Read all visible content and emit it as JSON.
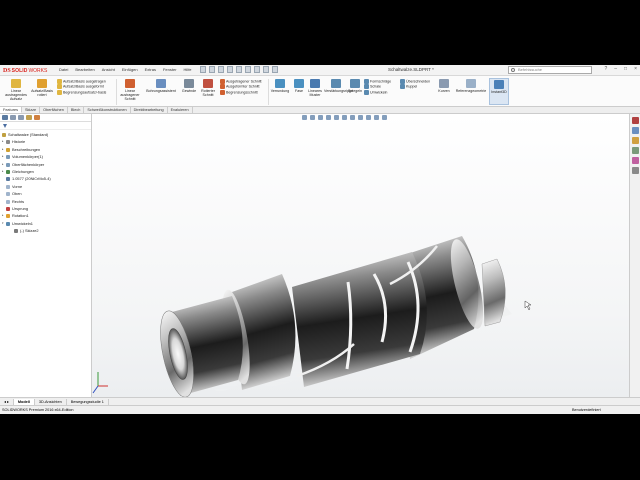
{
  "app": {
    "logo_prefix": "DS",
    "logo_bold": "SOLID",
    "logo_light": "WORKS",
    "document_title": "Schaltwalze.SLDPRT *",
    "search_placeholder": "Befehlssuche"
  },
  "menu": [
    "Datei",
    "Bearbeiten",
    "Ansicht",
    "Einfügen",
    "Extras",
    "Fenster",
    "Hilfe"
  ],
  "ribbon": {
    "big_buttons": [
      {
        "label": "Linear\naustragendes\nAufsatz",
        "icon": "boss-extrude-icon",
        "color": "#e0b640"
      },
      {
        "label": "Aufsatz/Basis\nrotiert",
        "icon": "revolved-boss-icon",
        "color": "#e0a030"
      },
      {
        "label": "Linear\naustragener\nSchnitt",
        "icon": "extruded-cut-icon",
        "color": "#d06030"
      },
      {
        "label": "Bohrungsassistent",
        "icon": "hole-wizard-icon",
        "color": "#6a8fc0"
      },
      {
        "label": "Gewinde",
        "icon": "thread-icon",
        "color": "#7a8a9a"
      },
      {
        "label": "Rotierter\nSchnitt",
        "icon": "revolved-cut-icon",
        "color": "#c05040"
      }
    ],
    "small_group_1": [
      "Aufsatz/Basis ausgetragen",
      "Aufsatz/Basis ausgeformt",
      "Begrenzungsaufsatz/-basis"
    ],
    "small_group_2": [
      "Ausgetragener Schnitt",
      "Ausgeformter Schnitt",
      "Begrenzungsschnitt"
    ],
    "feature_buttons": [
      {
        "label": "Verrundung",
        "icon": "fillet-icon",
        "color": "#4a90c0"
      },
      {
        "label": "Fase",
        "icon": "chamfer-icon",
        "color": "#4a90c0"
      },
      {
        "label": "Lineares\nMuster",
        "icon": "linear-pattern-icon",
        "color": "#4a7ab0"
      },
      {
        "label": "Verstärkungsrippe",
        "icon": "rib-icon",
        "color": "#5a8ab0"
      },
      {
        "label": "Spiegeln",
        "icon": "mirror-icon",
        "color": "#5a8ab0"
      }
    ],
    "small_group_3": [
      "Formschräge",
      "Schale",
      "Umwickeln"
    ],
    "small_group_4": [
      "Überschneiden",
      "Kuppel"
    ],
    "curves_label": "Kurven",
    "reference_label": "Referenzgeometrie",
    "instant3d_label": "Instant3D"
  },
  "command_tabs": [
    "Features",
    "Skizze",
    "Oberflächen",
    "Blech",
    "Schweißkonstruktionen",
    "Direktbearbeitung",
    "Evaluieren"
  ],
  "tree": {
    "root": "Schaltwalze (Standard)",
    "items": [
      {
        "label": "Historie",
        "color": "#8a8a8a",
        "indent": 1,
        "expander": "▸"
      },
      {
        "label": "Beschreibungen",
        "color": "#d0a030",
        "indent": 1,
        "expander": "▸"
      },
      {
        "label": "Volumenkörper(1)",
        "color": "#7a9ab8",
        "indent": 1,
        "expander": "▸"
      },
      {
        "label": "Oberflächenkörper",
        "color": "#7a9ab8",
        "indent": 1,
        "expander": "▸"
      },
      {
        "label": "Gleichungen",
        "color": "#4a8a4a",
        "indent": 1,
        "expander": "▸"
      },
      {
        "label": "1.0577 (20NiCrMo5-4)",
        "color": "#5a7aa0",
        "indent": 1,
        "expander": ""
      },
      {
        "label": "Vorne",
        "color": "#a0b4cc",
        "indent": 1,
        "expander": ""
      },
      {
        "label": "Oben",
        "color": "#a0b4cc",
        "indent": 1,
        "expander": ""
      },
      {
        "label": "Rechts",
        "color": "#a0b4cc",
        "indent": 1,
        "expander": ""
      },
      {
        "label": "Ursprung",
        "color": "#c04040",
        "indent": 1,
        "expander": ""
      },
      {
        "label": "Rotation1",
        "color": "#e0a030",
        "indent": 1,
        "expander": "▸"
      },
      {
        "label": "Umwickeln1",
        "color": "#5a8ab0",
        "indent": 1,
        "expander": "▾"
      },
      {
        "label": "(-) Skizze2",
        "color": "#7a7a7a",
        "indent": 2,
        "expander": ""
      }
    ]
  },
  "bottom_tabs": [
    "Modell",
    "3D-Ansichten",
    "Bewegungsstudie 1"
  ],
  "status": {
    "left": "SOLIDWORKS Premium 2016 x64-Edition",
    "right": "Benutzerdefiniert"
  },
  "colors": {
    "accent": "#d9221c",
    "ribbon_bg": "#fbfbfb",
    "viewport_top": "#ffffff",
    "part_dark": "#1a1a1a"
  }
}
